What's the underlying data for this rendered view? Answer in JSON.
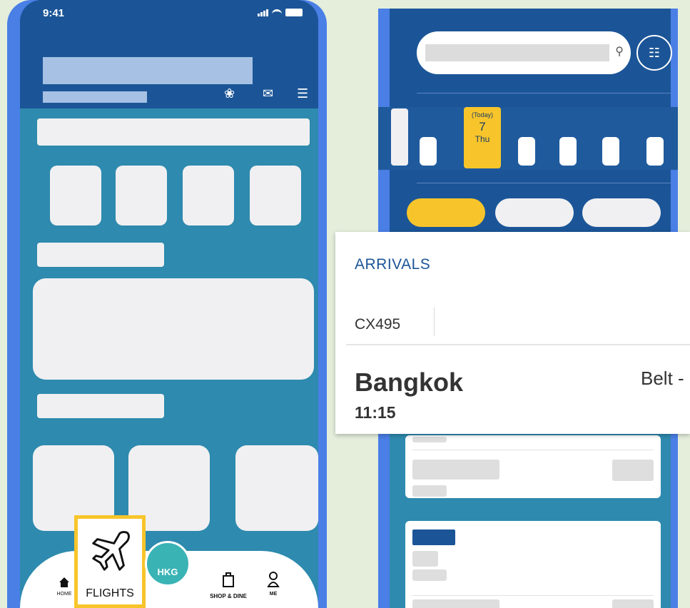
{
  "status_bar": {
    "time": "9:41"
  },
  "bottom_nav": {
    "home_label": "HOME",
    "flights_label": "FLIGHTS",
    "hkg_label": "HKG",
    "shop_label": "SHOP & DINE",
    "me_label": "ME"
  },
  "date_strip": {
    "today_label": "(Today)",
    "today_day": "7",
    "today_weekday": "Thu"
  },
  "arrivals": {
    "title": "ARRIVALS",
    "flight_number": "CX495",
    "city": "Bangkok",
    "time": "11:15",
    "belt_label": "Belt -"
  },
  "colors": {
    "header_blue": "#1b5597",
    "body_teal": "#2e8aae",
    "frame_blue": "#4a7fe6",
    "accent_yellow": "#f7c52b"
  }
}
